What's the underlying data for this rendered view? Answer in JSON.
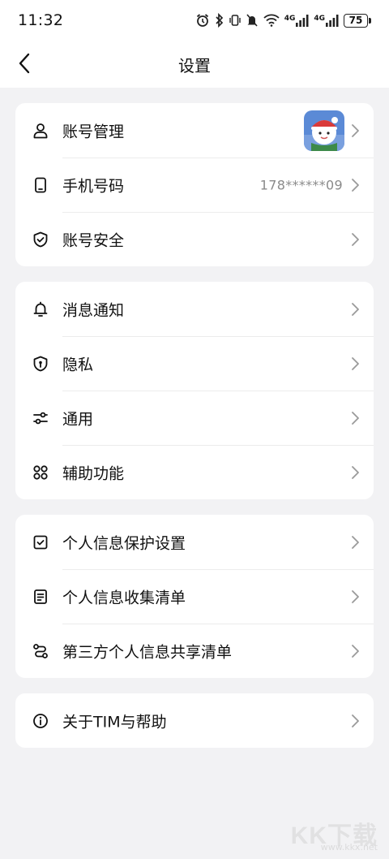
{
  "status_bar": {
    "time": "11:32",
    "battery": "75",
    "icons": [
      "alarm-icon",
      "bluetooth-icon",
      "vibrate-icon",
      "mute-icon",
      "wifi-icon",
      "signal-4g-icon",
      "signal-4g-icon",
      "battery-icon"
    ],
    "network_1": "4G",
    "network_2": "4G"
  },
  "nav": {
    "back_icon": "back-arrow-icon",
    "title": "设置"
  },
  "groups": [
    {
      "items": [
        {
          "icon": "user-icon",
          "label": "账号管理",
          "value": "",
          "has_avatar": true
        },
        {
          "icon": "phone-icon",
          "label": "手机号码",
          "value": "178******09"
        },
        {
          "icon": "shield-check-icon",
          "label": "账号安全",
          "value": ""
        }
      ]
    },
    {
      "items": [
        {
          "icon": "bell-icon",
          "label": "消息通知",
          "value": ""
        },
        {
          "icon": "privacy-shield-icon",
          "label": "隐私",
          "value": ""
        },
        {
          "icon": "sliders-icon",
          "label": "通用",
          "value": ""
        },
        {
          "icon": "grid-icon",
          "label": "辅助功能",
          "value": ""
        }
      ]
    },
    {
      "items": [
        {
          "icon": "check-box-icon",
          "label": "个人信息保护设置",
          "value": ""
        },
        {
          "icon": "document-icon",
          "label": "个人信息收集清单",
          "value": ""
        },
        {
          "icon": "share-icon",
          "label": "第三方个人信息共享清单",
          "value": ""
        }
      ]
    },
    {
      "items": [
        {
          "icon": "info-icon",
          "label": "关于TIM与帮助",
          "value": ""
        }
      ]
    }
  ],
  "watermark": {
    "logo_text": "KK下载",
    "url": "www.kkx.net"
  },
  "colors": {
    "background": "#f2f2f4",
    "card": "#ffffff",
    "secondary_text": "#8a8a8a",
    "chevron": "#9a9a9a"
  }
}
